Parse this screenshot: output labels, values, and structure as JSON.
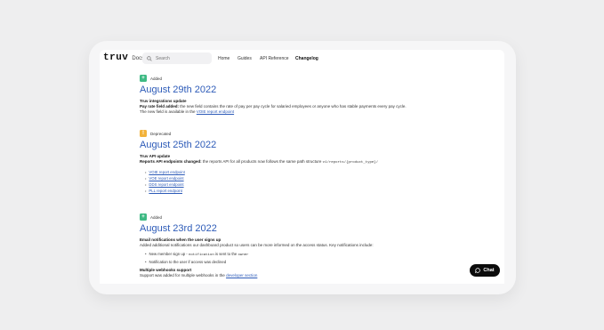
{
  "header": {
    "logo_word": "truv",
    "logo_suffix": "Docs",
    "search_placeholder": "Search",
    "nav": [
      "Home",
      "Guides",
      "API Reference",
      "Changelog"
    ]
  },
  "entries": [
    {
      "tag": "Added",
      "tag_color": "#3fba84",
      "title": "August 29th 2022",
      "subtitle": "Truv integrations update",
      "line1_bold": "Pay rate field added:",
      "line1_text": " the new field contains the rate of pay per pay cycle for salaried employees or anyone who has stable payments every pay cycle.",
      "line2_text": "The new field is available in the ",
      "line2_link": "VOIE report endpoint"
    },
    {
      "tag": "Deprecated",
      "tag_color": "#f2b23a",
      "title": "August 25th 2022",
      "subtitle": "Truv API update",
      "line1_bold": "Reports API endpoints changed:",
      "line1_text": " the reports API for all products now follows the same path structure ",
      "line1_code": "v1/reports/{product_type}/",
      "links": [
        "VOIE report endpoint",
        "VOE report endpoint",
        "DDS report endpoint",
        "PLL report endpoint"
      ]
    },
    {
      "tag": "Added",
      "tag_color": "#3fba84",
      "title": "August 23rd 2022",
      "subtitle": "Email notifications when the user signs up",
      "line1_text": "Added additional notifications our dashboard product so users can be more informed on the access status. Key notifications include:",
      "bullet1_a": "New member sign up - ",
      "bullet1_code": "notification",
      "bullet1_b": " is sent to the ",
      "bullet1_code2": "owner",
      "bullet2": "Notification to the user if access was declined",
      "subtitle2": "Multiple webhooks support",
      "line2_text": "Support was added for multiple webhooks in the ",
      "line2_link": "developer section"
    }
  ],
  "chat": {
    "label": "Chat"
  }
}
